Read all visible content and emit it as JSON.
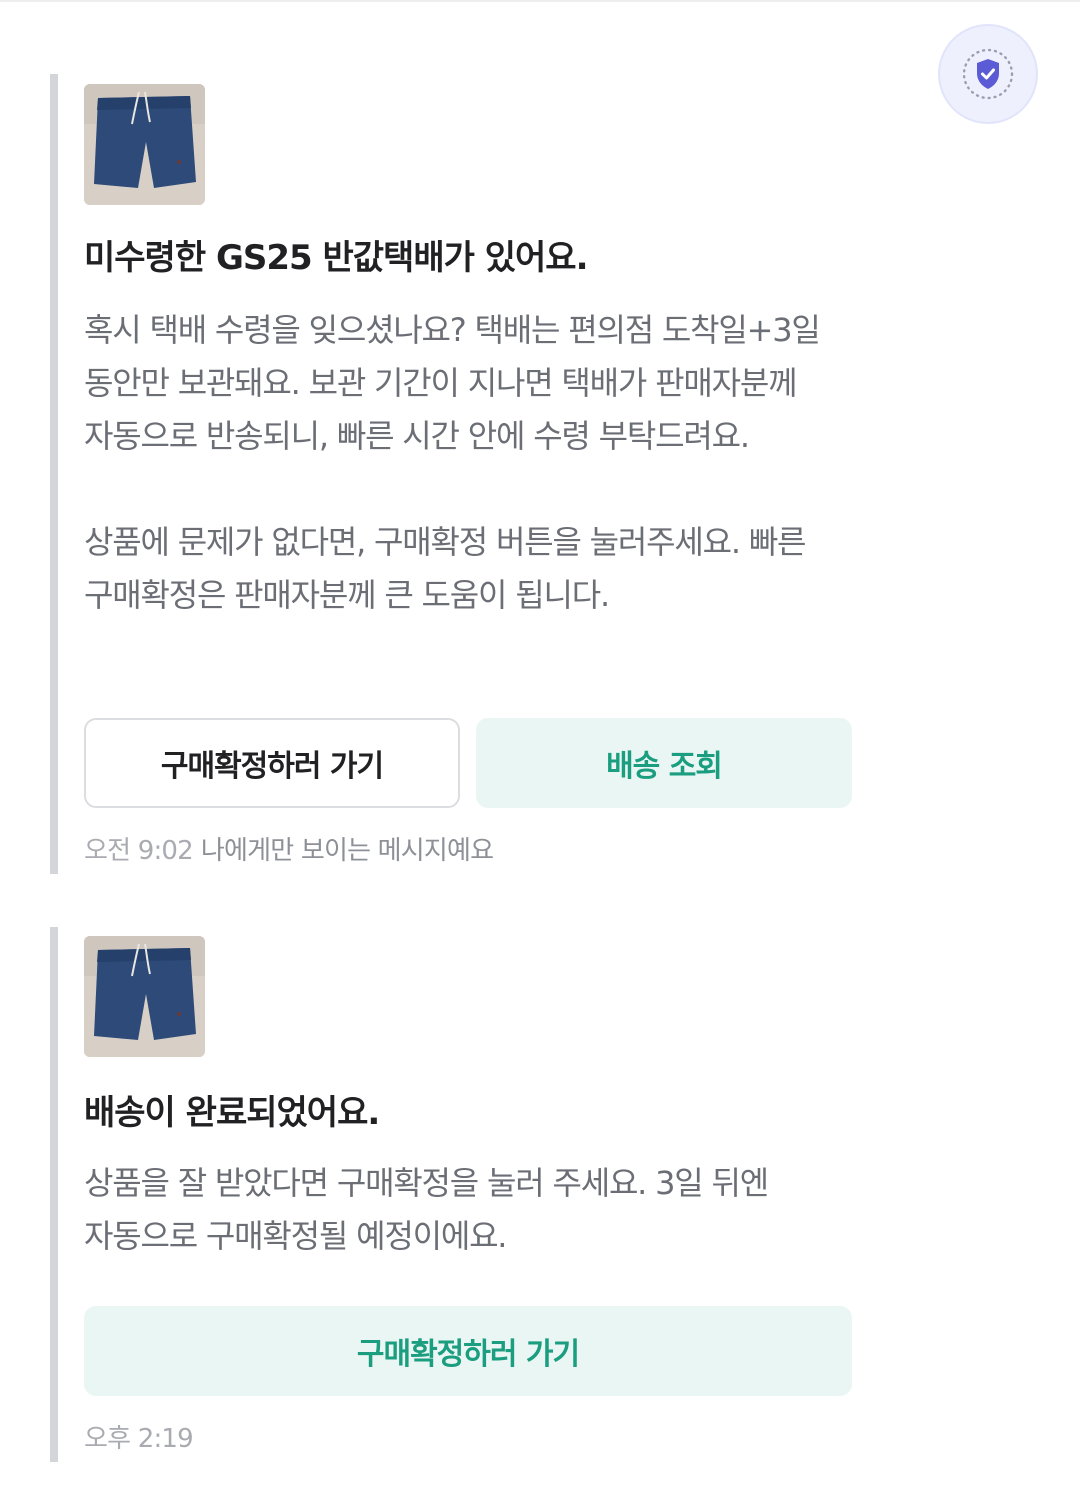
{
  "colors": {
    "accent_mint": "#1a9e7f",
    "mint_bg": "#eaf6f4",
    "shield_bg": "#eef0fd",
    "shield_icon": "#5b5bd6"
  },
  "header": {
    "shield_icon": "shield-check-icon"
  },
  "messages": [
    {
      "thumbnail": "shorts-product-image",
      "title": "미수령한 GS25 반값택배가 있어요.",
      "body": "혹시 택배 수령을 잊으셨나요? 택배는 편의점 도착일+3일 동안만 보관돼요. 보관 기간이 지나면 택배가 판매자분께 자동으로 반송되니, 빠른 시간 안에 수령 부탁드려요.\n\n상품에 문제가 없다면, 구매확정 버튼을 눌러주세요. 빠른 구매확정은 판매자분께 큰 도움이 됩니다.",
      "buttons": [
        "구매확정하러 가기",
        "배송 조회"
      ],
      "time": "오전 9:02",
      "note": "나에게만 보이는 메시지예요"
    },
    {
      "thumbnail": "shorts-product-image",
      "title": "배송이 완료되었어요.",
      "body": "상품을 잘 받았다면 구매확정을 눌러 주세요. 3일 뒤엔 자동으로 구매확정될 예정이에요.",
      "buttons": [
        "구매확정하러 가기"
      ],
      "time": "오후 2:19"
    }
  ]
}
